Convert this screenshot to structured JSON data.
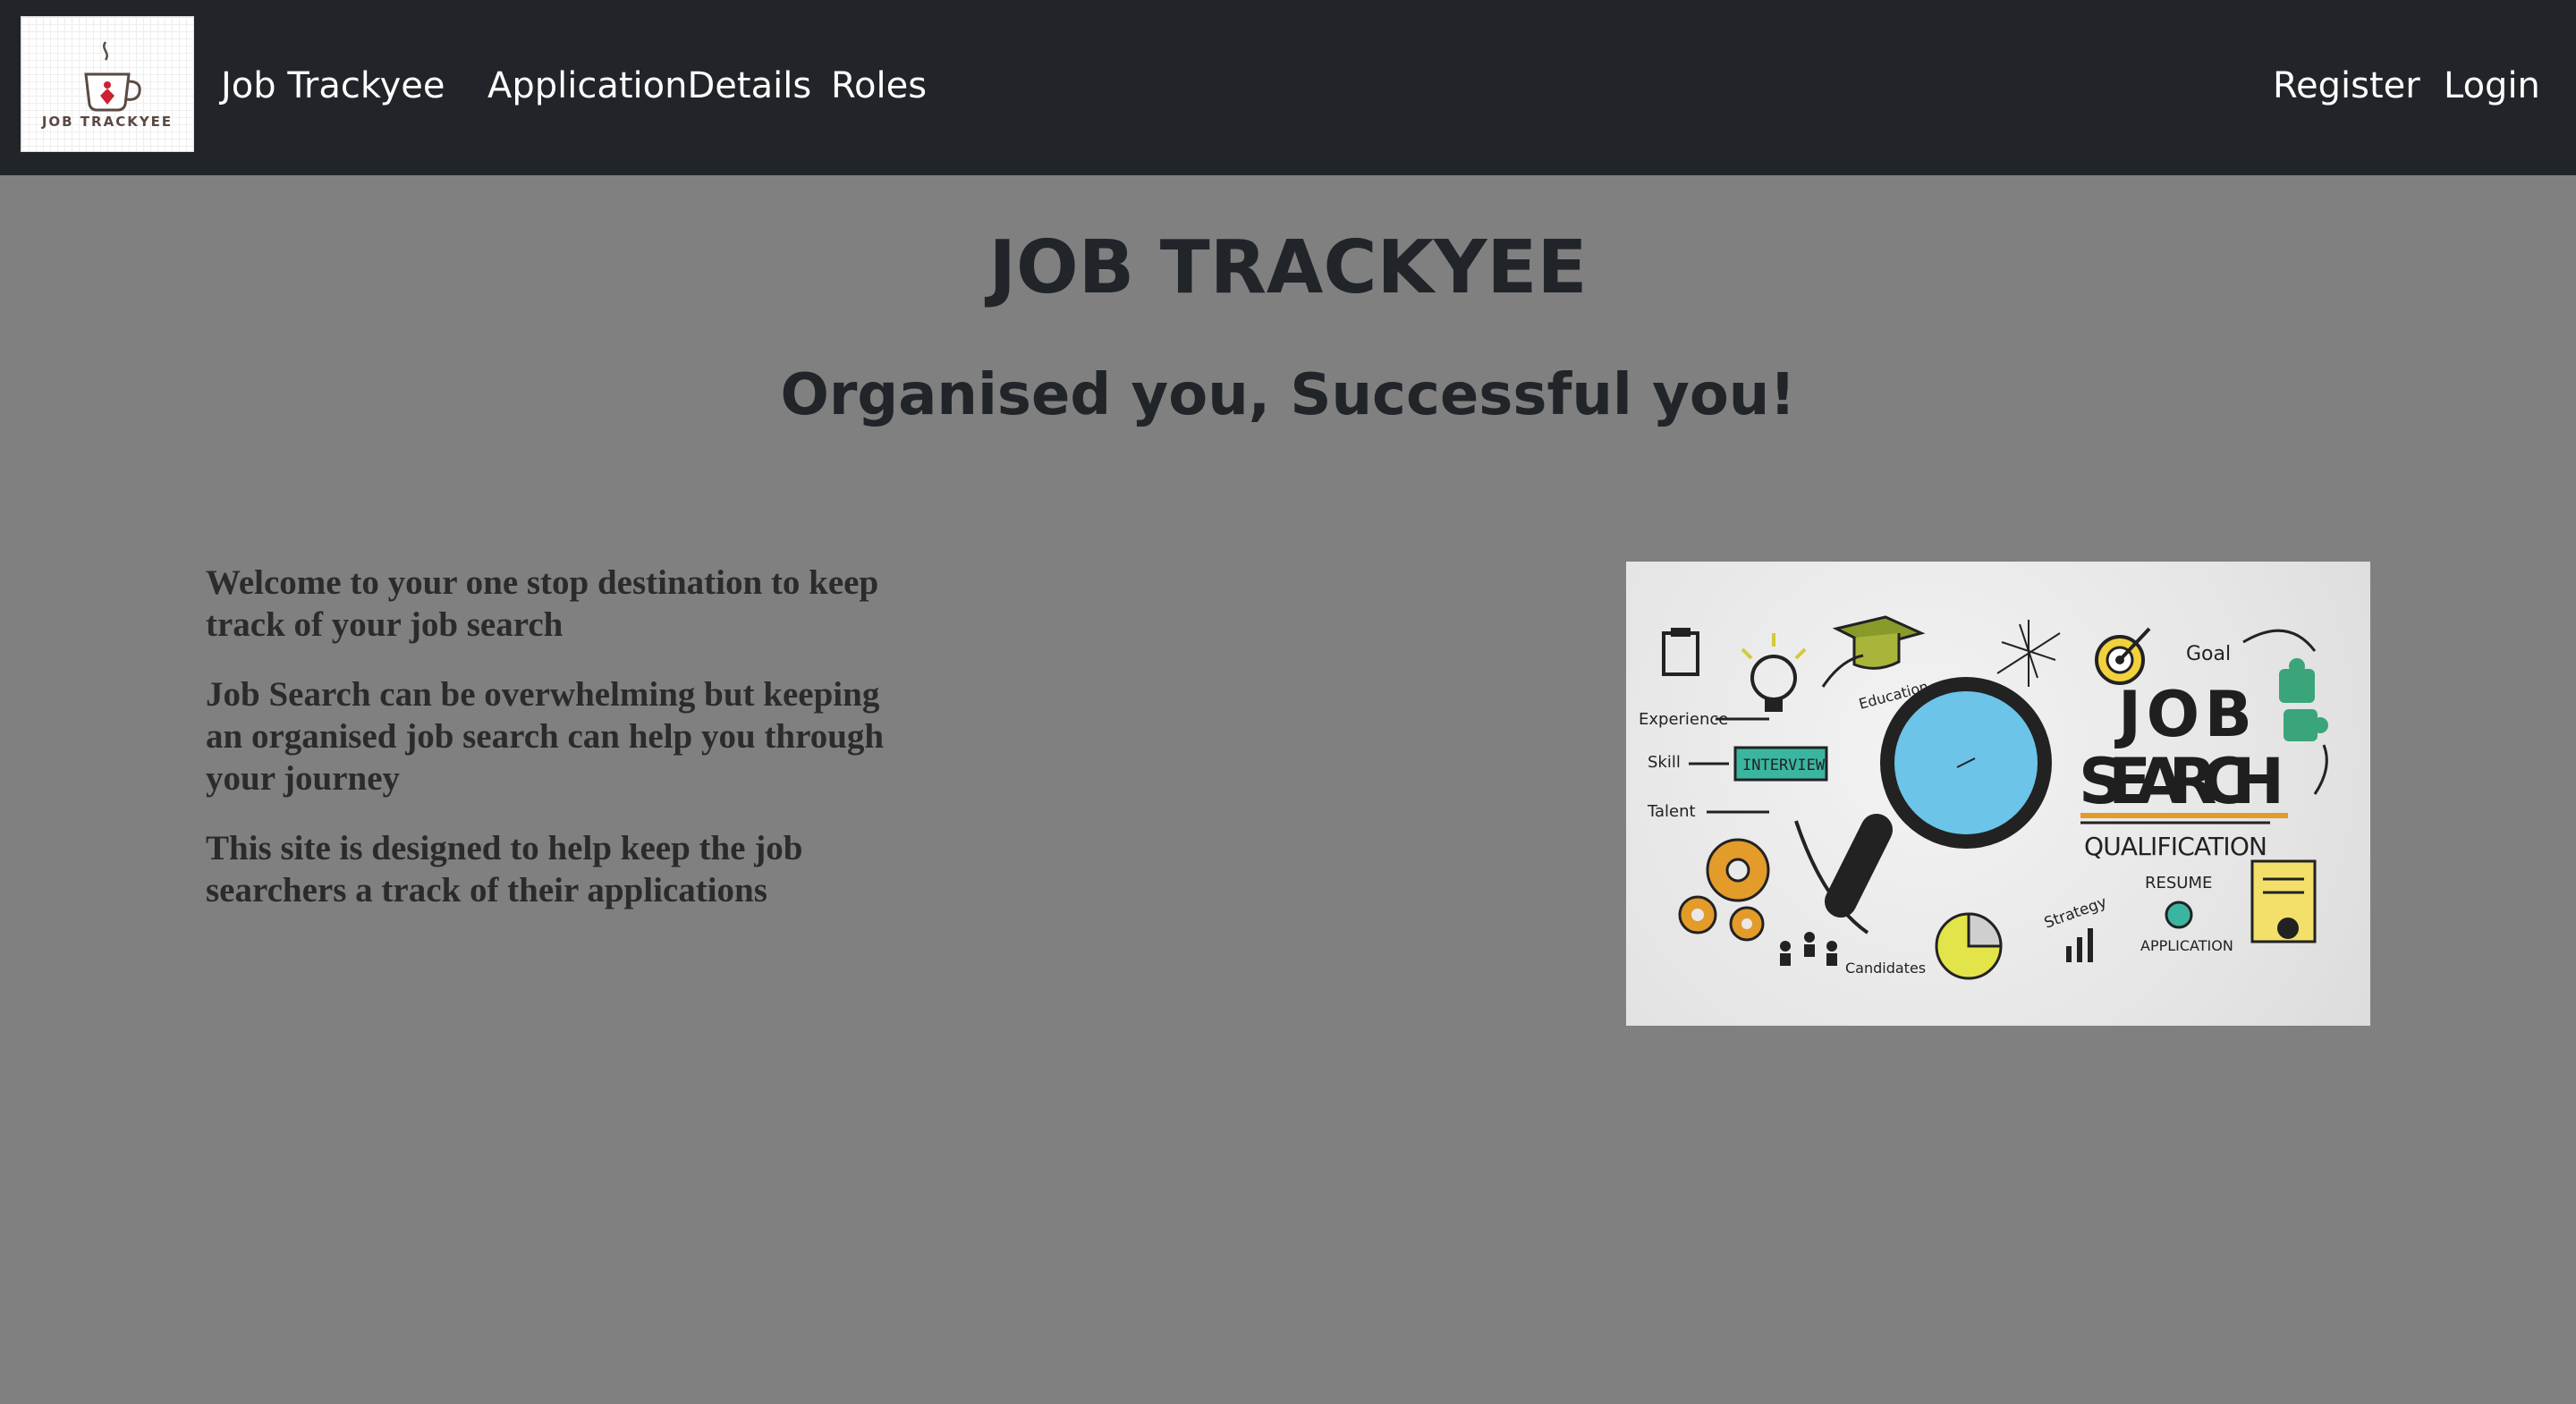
{
  "navbar": {
    "logo_text": "JOB TRACKYEE",
    "brand": "Job Trackyee",
    "links": [
      "ApplicationDetails",
      "Roles"
    ],
    "right_links": [
      "Register",
      "Login"
    ]
  },
  "main": {
    "title": "JOB TRACKYEE",
    "subtitle": "Organised you, Successful you!",
    "paragraphs": [
      "Welcome to your one stop destination to keep track of your job search",
      "Job Search can be overwhelming but keeping an organised job search can help you through your journey",
      "This site is designed to help keep the job searchers a track of their applications"
    ]
  },
  "hero_image": {
    "headline_line1": "JOB",
    "headline_line2": "SEARCH",
    "labels": {
      "qualification": "QUALIFICATION",
      "resume": "RESUME",
      "application": "APPLICATION",
      "goal": "Goal",
      "experience": "Experience",
      "skill": "Skill",
      "talent": "Talent",
      "interview": "INTERVIEW",
      "education": "Education",
      "strategy": "Strategy",
      "candidates": "Candidates"
    }
  },
  "colors": {
    "navbar_bg": "#212529",
    "page_bg": "#808080",
    "text_dark": "#212529",
    "nav_text": "#ffffff"
  }
}
